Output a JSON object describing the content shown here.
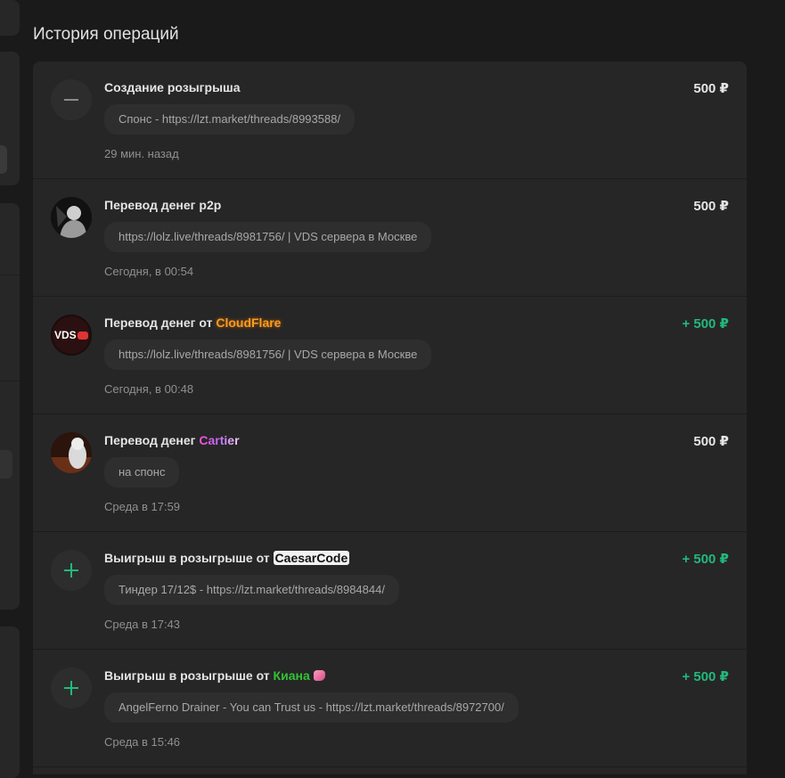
{
  "page": {
    "title": "История операций"
  },
  "operations": [
    {
      "icon": "minus-icon",
      "title": "Создание розыгрыша",
      "user": "",
      "amount": "500 ₽",
      "amount_type": "neutral",
      "comment": "Спонс - https://lzt.market/threads/8993588/",
      "time": "29 мин. назад"
    },
    {
      "icon": "user-avatar",
      "title": "Перевод денег",
      "user": "p2p",
      "amount": "500 ₽",
      "amount_type": "neutral",
      "comment": "https://lolz.live/threads/8981756/ | VDS сервера в Москве",
      "time": "Сегодня, в 00:54"
    },
    {
      "icon": "vds-logo-avatar",
      "title": "Перевод денег от",
      "user": "CloudFlare",
      "amount": "+ 500 ₽",
      "amount_type": "plus",
      "comment": "https://lolz.live/threads/8981756/ | VDS сервера в Москве",
      "time": "Сегодня, в 00:48"
    },
    {
      "icon": "cat-avatar",
      "title": "Перевод денег",
      "user": "Cartier",
      "amount": "500 ₽",
      "amount_type": "neutral",
      "comment": "на спонс",
      "time": "Среда в 17:59"
    },
    {
      "icon": "plus-icon",
      "title": "Выигрыш в розыгрыше от",
      "user": "CaesarCode",
      "amount": "+ 500 ₽",
      "amount_type": "plus",
      "comment": "Тиндер 17/12$ - https://lzt.market/threads/8984844/",
      "time": "Среда в 17:43"
    },
    {
      "icon": "plus-icon",
      "title": "Выигрыш в розыгрыше от",
      "user": "Киана",
      "amount": "+ 500 ₽",
      "amount_type": "plus",
      "comment": "AngelFerno Drainer - You can Trust us - https://lzt.market/threads/8972700/",
      "time": "Среда в 15:46"
    }
  ],
  "colors": {
    "background": "#1a1a1a",
    "card": "#262626",
    "comment_bubble": "#2e2e2e",
    "plus_amount": "#22b97d",
    "cloudflare_user": "#ff9a1f",
    "kiana_user": "#33c233"
  }
}
